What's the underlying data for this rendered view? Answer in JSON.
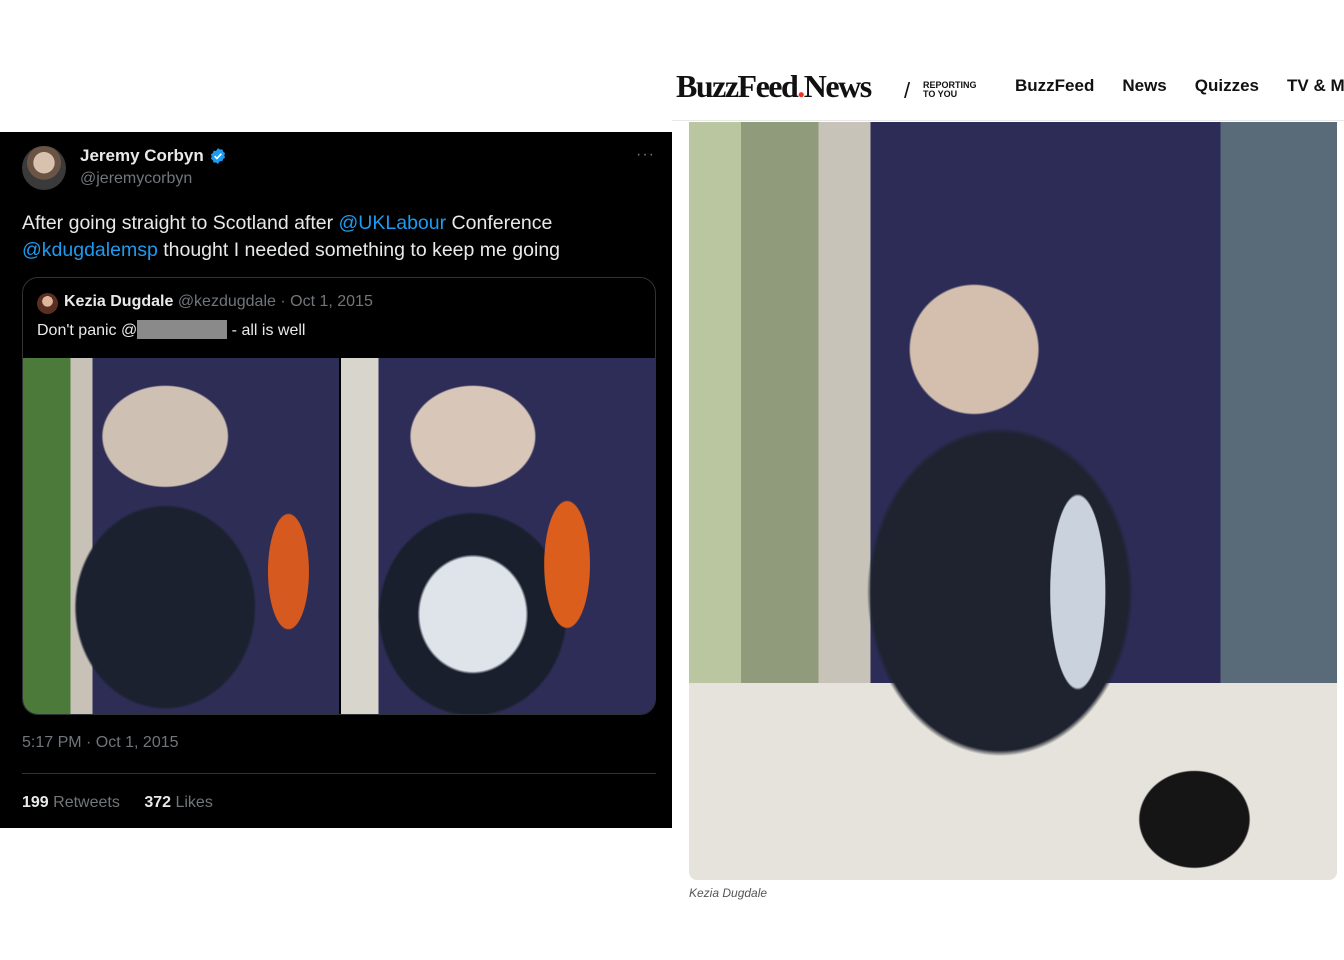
{
  "tweet": {
    "author_name": "Jeremy Corbyn",
    "author_handle": "@jeremycorbyn",
    "text_parts": {
      "a": "After going straight to Scotland after ",
      "m1": "@UKLabour",
      "b": " Conference ",
      "m2": "@kdugdalemsp",
      "c": " thought I needed something to keep me going"
    },
    "quote": {
      "name": "Kezia Dugdale",
      "meta": "@kezdugdale · Oct 1, 2015",
      "text_before": "Don't panic @",
      "text_after": " - all is well"
    },
    "timestamp": "5:17 PM · Oct 1, 2015",
    "retweets_count": "199",
    "retweets_label": "Retweets",
    "likes_count": "372",
    "likes_label": "Likes",
    "more_label": "···"
  },
  "buzzfeed": {
    "logo_main": "BuzzFeed",
    "logo_dot": ".",
    "logo_news": "News",
    "slash": "/",
    "tagline": "REPORTING\nTO YOU",
    "nav": [
      "BuzzFeed",
      "News",
      "Quizzes",
      "TV & M"
    ],
    "caption": "Kezia Dugdale"
  }
}
